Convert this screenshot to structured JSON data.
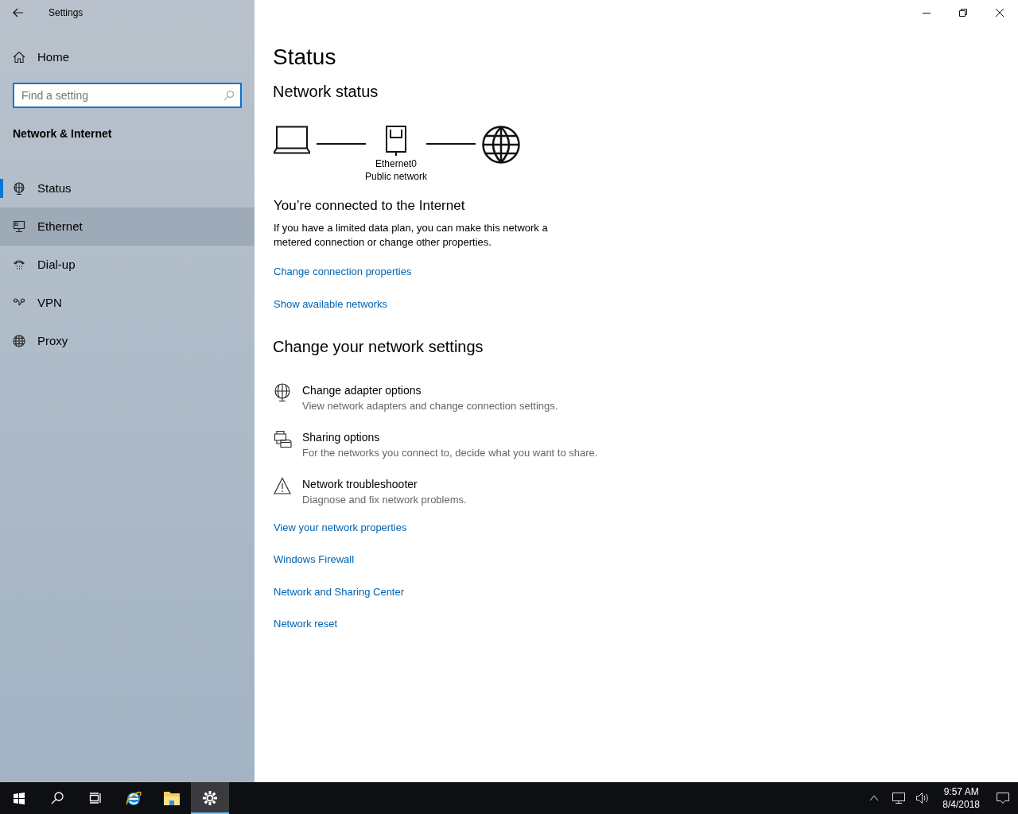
{
  "window": {
    "title": "Settings"
  },
  "sidebar": {
    "home": "Home",
    "search": {
      "placeholder": "Find a setting"
    },
    "section": "Network & Internet",
    "items": [
      {
        "label": "Status",
        "kind": "status",
        "selected": true,
        "hovered": false
      },
      {
        "label": "Ethernet",
        "kind": "ethernet",
        "selected": false,
        "hovered": true
      },
      {
        "label": "Dial-up",
        "kind": "dialup",
        "selected": false,
        "hovered": false
      },
      {
        "label": "VPN",
        "kind": "vpn",
        "selected": false,
        "hovered": false
      },
      {
        "label": "Proxy",
        "kind": "proxy",
        "selected": false,
        "hovered": false
      }
    ]
  },
  "main": {
    "title": "Status",
    "network_status": {
      "heading": "Network status",
      "adapter": "Ethernet0",
      "network_type": "Public network"
    },
    "connected": {
      "heading": "You’re connected to the Internet",
      "text": "If you have a limited data plan, you can make this network a metered connection or change other properties."
    },
    "links_top": [
      "Change connection properties",
      "Show available networks"
    ],
    "change_heading": "Change your network settings",
    "options": [
      {
        "kind": "adapter",
        "title": "Change adapter options",
        "description": "View network adapters and change connection settings."
      },
      {
        "kind": "sharing",
        "title": "Sharing options",
        "description": "For the networks you connect to, decide what you want to share."
      },
      {
        "kind": "warning",
        "title": "Network troubleshooter",
        "description": "Diagnose and fix network problems."
      }
    ],
    "links_bottom": [
      "View your network properties",
      "Windows Firewall",
      "Network and Sharing Center",
      "Network reset"
    ]
  },
  "taskbar": {
    "apps": [
      {
        "kind": "start",
        "active": false
      },
      {
        "kind": "search",
        "active": false
      },
      {
        "kind": "taskview",
        "active": false
      },
      {
        "kind": "browser",
        "active": false
      },
      {
        "kind": "folder",
        "active": false
      },
      {
        "kind": "settings",
        "active": true
      }
    ],
    "time": "9:57 AM",
    "date": "8/4/2018"
  }
}
